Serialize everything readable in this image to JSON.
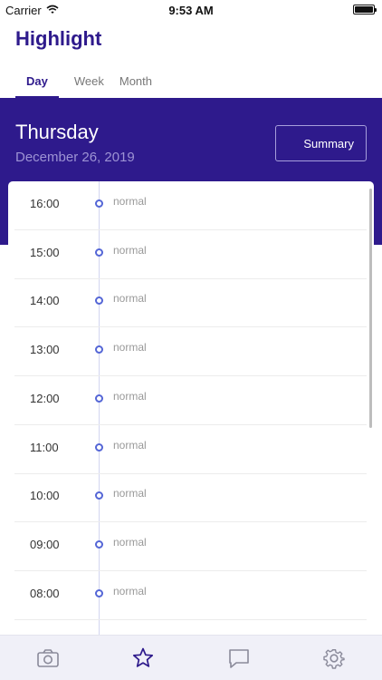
{
  "status_bar": {
    "carrier": "Carrier",
    "time": "9:53 AM"
  },
  "header": {
    "title": "Highlight"
  },
  "tabs": [
    {
      "label": "Day",
      "active": true
    },
    {
      "label": "Week",
      "active": false
    },
    {
      "label": "Month",
      "active": false
    }
  ],
  "day_header": {
    "day_name": "Thursday",
    "date": "December 26, 2019",
    "summary_label": "Summary"
  },
  "timeline": {
    "rows": [
      {
        "time": "16:00",
        "status": "normal"
      },
      {
        "time": "15:00",
        "status": "normal"
      },
      {
        "time": "14:00",
        "status": "normal"
      },
      {
        "time": "13:00",
        "status": "normal"
      },
      {
        "time": "12:00",
        "status": "normal"
      },
      {
        "time": "11:00",
        "status": "normal"
      },
      {
        "time": "10:00",
        "status": "normal"
      },
      {
        "time": "09:00",
        "status": "normal"
      },
      {
        "time": "08:00",
        "status": "normal"
      }
    ]
  },
  "bottom_tabs": [
    {
      "icon": "camera-icon",
      "active": false
    },
    {
      "icon": "star-icon",
      "active": true
    },
    {
      "icon": "chat-icon",
      "active": false
    },
    {
      "icon": "gear-icon",
      "active": false
    }
  ],
  "colors": {
    "brand": "#2e1a8c",
    "accent_dot": "#5466d6",
    "date_text": "#9d93d4",
    "tab_bar_bg": "#f0f0f8"
  }
}
